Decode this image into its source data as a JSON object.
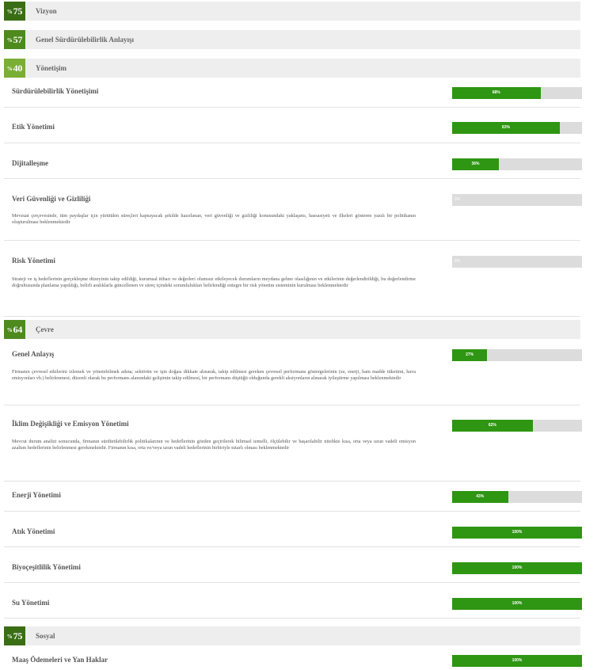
{
  "sections": {
    "vizyon": {
      "prefix": "%",
      "score": "75",
      "title": "Vizyon",
      "color": "#3a6e15"
    },
    "genel": {
      "prefix": "%",
      "score": "57",
      "title": "Genel Sürdürülebilirlik Anlayışı",
      "color": "#4e8a1e"
    },
    "yonetisim": {
      "prefix": "%",
      "score": "40",
      "title": "Yönetişim",
      "color": "#7aae34"
    },
    "cevre": {
      "prefix": "%",
      "score": "64",
      "title": "Çevre",
      "color": "#4e8a1e"
    },
    "sosyal": {
      "prefix": "%",
      "score": "75",
      "title": "Sosyal",
      "color": "#3a6e15"
    }
  },
  "items": [
    {
      "title": "Sürdürülebilirlik Yönetişimi",
      "percent": 68,
      "label": "68%",
      "desc": ""
    },
    {
      "title": "Etik Yönetimi",
      "percent": 83,
      "label": "83%",
      "desc": ""
    },
    {
      "title": "Dijitalleşme",
      "percent": 36,
      "label": "36%",
      "desc": ""
    },
    {
      "title": "Veri Güvenliği ve Gizliliği",
      "percent": 0,
      "label": "0%",
      "desc": "Mevzuat çerçevesinde, tüm paydaşlar için yürütülen süreçleri kapsayacak şekilde hazırlanan, veri güvenliği ve gizliliği konusundaki yaklaşımı, hassasiyeti ve ilkeleri gösteren yazılı bir politikanın oluşturulması beklenmektedir"
    },
    {
      "title": "Risk Yönetimi",
      "percent": 0,
      "label": "0%",
      "desc": "Strateji ve iş hedeflerinin gerçekleşme düzeyinin takip edildiği, kurumsal itibarı ve değerleri olumsuz etkileyecek durumların meydana gelme olasılığının ve etkilerinin değerlendirildiği, bu değerlendirme doğrultusunda planlama yapıldığı, belirli aralıklarla güncellenen ve süreç içindeki sorumlulukları belirlendiği entegre bir risk yönetim sisteminin kurulması beklenmektedir"
    },
    {
      "title": "Genel Anlayış",
      "percent": 27,
      "label": "27%",
      "desc": "Firmanın çevresel etkilerini izlemek ve yönetebilmek adına; sektörün ve işin doğası dikkate alınarak, takip edilmesi gereken çevresel performans göstergelerinin (su, enerji, ham madde tüketimi, hava emisyonları vb.) belirlenmesi; düzenli olarak bu performans alanındaki gelişimin takip edilmesi, bir performans düştüğü olduğunda gerekli aksiyonların alınarak iyileştirme yapılması beklenmektedir"
    },
    {
      "title": "İklim Değişikliği ve Emisyon Yönetimi",
      "percent": 62,
      "label": "62%",
      "desc": "Mevcut durum analizi sonucunda, firmanın sürdürülebilirlik politikalarının ve hedeflerinin gözden geçirilerek bilimsel temelli, ölçülebilir ve başarılabilir nitelikte kısa, orta veya uzun vadeli emisyon azaltım hedeflerinin belirlenmesi gerekmektedir. Firmanın kısa, orta ve/veya uzun vadeli hedeflerinin birbiriyle tutarlı olması beklenmektedir"
    },
    {
      "title": "Enerji Yönetimi",
      "percent": 43,
      "label": "43%",
      "desc": ""
    },
    {
      "title": "Atık Yönetimi",
      "percent": 100,
      "label": "100%",
      "desc": ""
    },
    {
      "title": "Biyoçeşitlilik Yönetimi",
      "percent": 100,
      "label": "100%",
      "desc": ""
    },
    {
      "title": "Su Yönetimi",
      "percent": 100,
      "label": "100%",
      "desc": ""
    },
    {
      "title": "Maaş Ödemeleri ve Yan Haklar",
      "percent": 100,
      "label": "100%",
      "desc": ""
    }
  ],
  "colors": {
    "bar_fill": "#2e9612",
    "bar_bg": "#dcdcdc",
    "section_bg": "#eeeeee"
  }
}
